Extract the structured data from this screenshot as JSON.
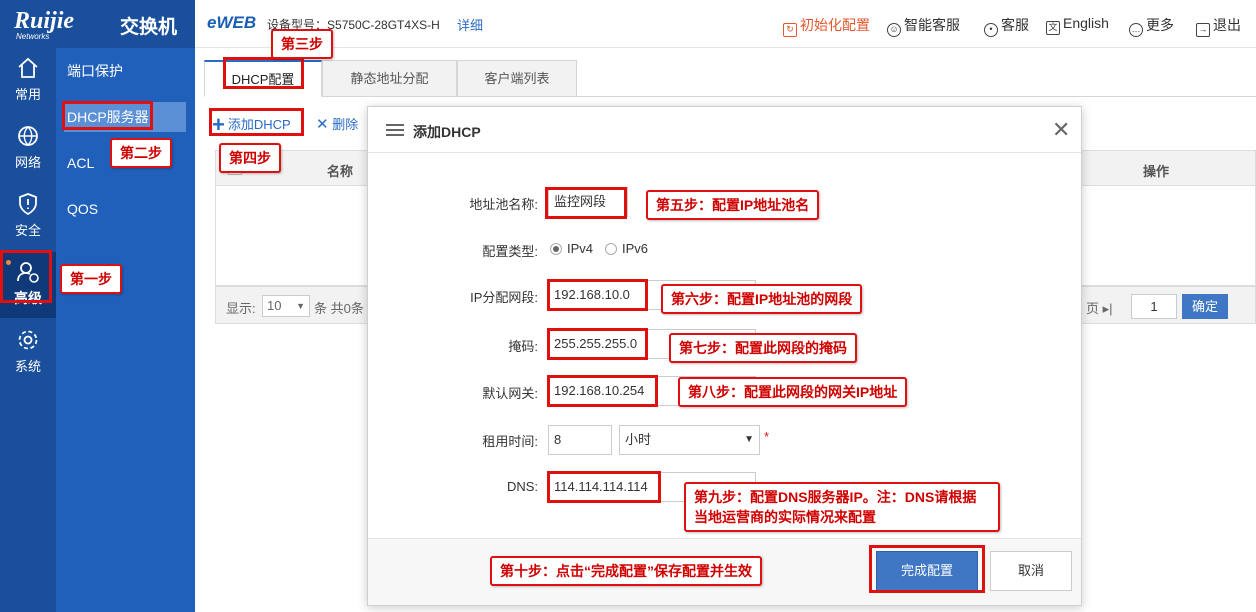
{
  "brand": {
    "logo": "Ruijie",
    "logo_sub": "Networks",
    "product": "交换机"
  },
  "topbar": {
    "eweb": "eWEB",
    "model_label": "设备型号：",
    "model": "S5750C-28GT4XS-H",
    "detail": "详细",
    "nav": [
      {
        "label": "初始化配置",
        "icon": "init-icon"
      },
      {
        "label": "智能客服",
        "icon": "smart-service-icon"
      },
      {
        "label": "客服",
        "icon": "user-service-icon"
      },
      {
        "label": "English",
        "icon": "language-icon"
      },
      {
        "label": "更多",
        "icon": "more-icon"
      },
      {
        "label": "退出",
        "icon": "logout-icon"
      }
    ],
    "accent": "#e4572e"
  },
  "nav_primary": [
    {
      "label": "常用",
      "icon": "home-icon"
    },
    {
      "label": "网络",
      "icon": "network-icon"
    },
    {
      "label": "安全",
      "icon": "shield-icon"
    },
    {
      "label": "高级",
      "icon": "advanced-user-icon",
      "active": true
    },
    {
      "label": "系统",
      "icon": "gear-icon"
    }
  ],
  "nav_secondary": [
    {
      "label": "端口保护"
    },
    {
      "label": "DHCP服务器",
      "active": true
    },
    {
      "label": "ACL"
    },
    {
      "label": "QOS"
    }
  ],
  "tabs": [
    "DHCP配置",
    "静态地址分配",
    "客户端列表"
  ],
  "toolbar": {
    "add": "添加DHCP",
    "delete": "删除"
  },
  "grid": {
    "columns": [
      "名称",
      "操作"
    ]
  },
  "pager": {
    "show_label": "显示:",
    "page_size": "10",
    "summary": "条 共0条",
    "page_suffix": "页",
    "page": "1",
    "confirm": "确定"
  },
  "modal": {
    "title": "添加DHCP",
    "fields": {
      "pool_name": {
        "label": "地址池名称:",
        "value": "监控网段"
      },
      "config_type": {
        "label": "配置类型:",
        "options": [
          "IPv4",
          "IPv6"
        ],
        "selected": "IPv4"
      },
      "ip_segment": {
        "label": "IP分配网段:",
        "value": "192.168.10.0"
      },
      "mask": {
        "label": "掩码:",
        "value": "255.255.255.0"
      },
      "gateway": {
        "label": "默认网关:",
        "value": "192.168.10.254"
      },
      "lease": {
        "label": "租用时间:",
        "value": "8",
        "unit": "小时",
        "required": "*"
      },
      "dns": {
        "label": "DNS:",
        "value": "114.114.114.114"
      }
    },
    "buttons": {
      "done": "完成配置",
      "cancel": "取消"
    }
  },
  "annotations": {
    "step1": "第一步",
    "step2": "第二步",
    "step3": "第三步",
    "step4": "第四步",
    "step5": "第五步：配置IP地址池名",
    "step6": "第六步：配置IP地址池的网段",
    "step7": "第七步：配置此网段的掩码",
    "step8": "第八步：配置此网段的网关IP地址",
    "step9": "第九步：配置DNS服务器IP。注：DNS请根据当地运营商的实际情况来配置",
    "step10": "第十步：点击“完成配置”保存配置并生效",
    "color": "#e01010"
  }
}
